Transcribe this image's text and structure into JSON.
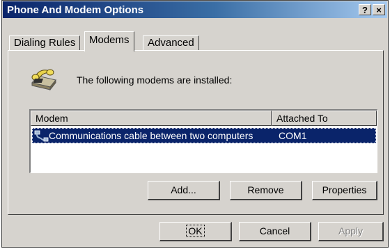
{
  "window": {
    "title": "Phone And Modem Options",
    "help_label": "?",
    "close_label": "×"
  },
  "tabs": [
    {
      "label": "Dialing Rules"
    },
    {
      "label": "Modems"
    },
    {
      "label": "Advanced"
    }
  ],
  "intro": {
    "text": "The following modems are  installed:"
  },
  "modem_list": {
    "columns": [
      "Modem",
      "Attached To"
    ],
    "rows": [
      {
        "name": "Communications cable between two computers",
        "port": "COM1",
        "selected": true
      }
    ]
  },
  "buttons": {
    "add": "Add...",
    "remove": "Remove",
    "properties": "Properties"
  },
  "footer": {
    "ok": "OK",
    "cancel": "Cancel",
    "apply": "Apply"
  },
  "icons": {
    "phone": "telephone-modem-icon",
    "cable": "serial-cable-icon"
  },
  "colors": {
    "titlebar_start": "#0a246a",
    "titlebar_end": "#a6caf0",
    "selection": "#0a246a",
    "face": "#d6d3ce"
  }
}
